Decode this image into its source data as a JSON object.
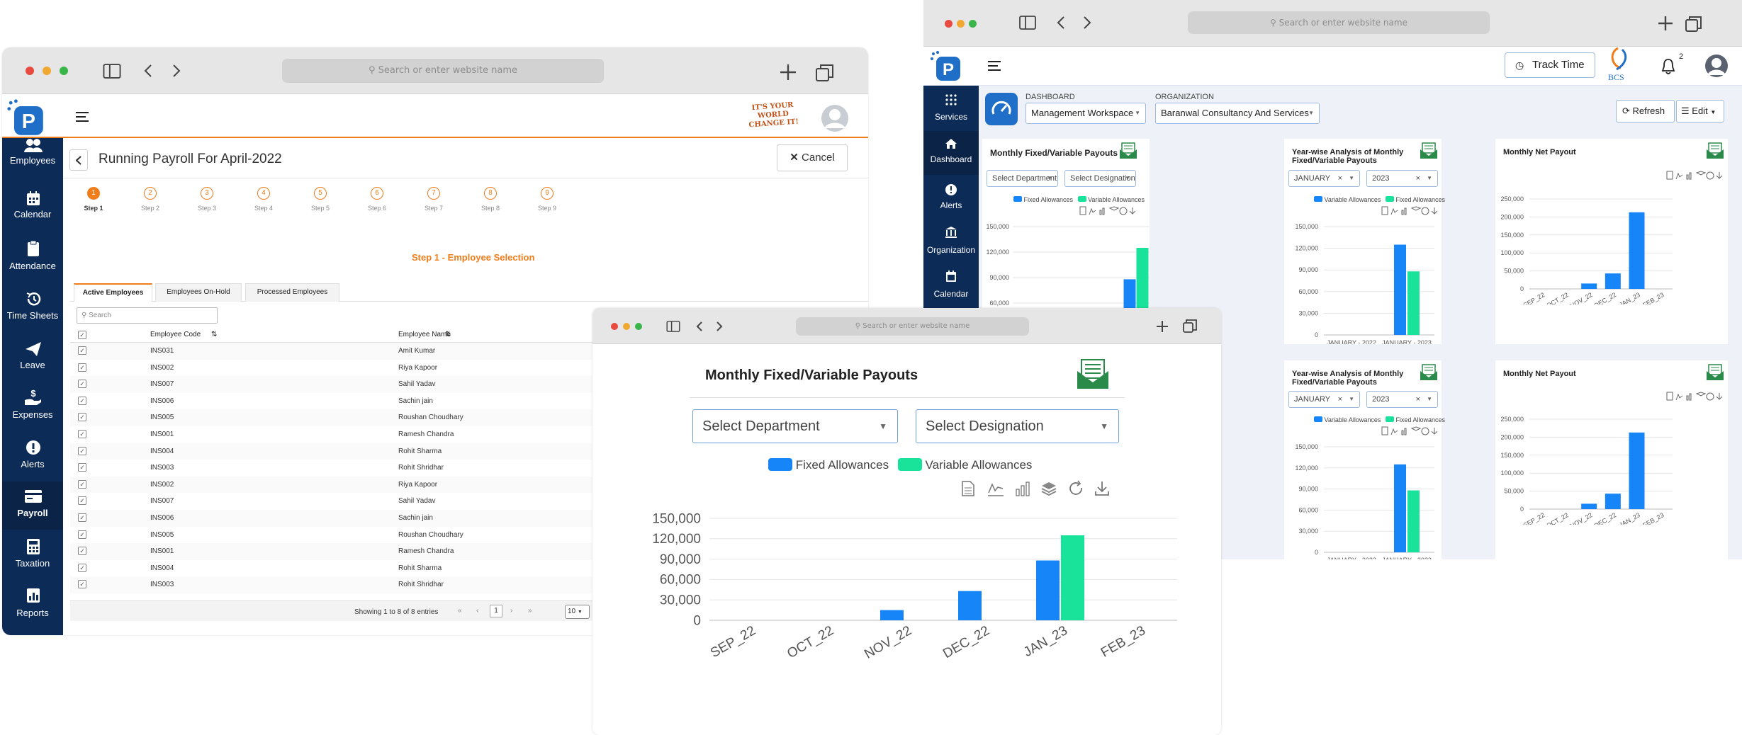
{
  "colors": {
    "sidebar": "#0d2b57",
    "accent": "#f07d1a",
    "blue": "#1685f7",
    "green": "#19e29a",
    "nav_active": "#0b2347"
  },
  "browser": {
    "url_placeholder": "Search or enter website name"
  },
  "left": {
    "logo_tagline": "IT'S YOUR WORLD CHANGE IT!",
    "sidebar": [
      {
        "label": "Employees",
        "icon": "users-icon"
      },
      {
        "label": "Calendar",
        "icon": "calendar-icon"
      },
      {
        "label": "Attendance",
        "icon": "clipboard-icon"
      },
      {
        "label": "Time Sheets",
        "icon": "history-icon"
      },
      {
        "label": "Leave",
        "icon": "paper-plane-icon"
      },
      {
        "label": "Expenses",
        "icon": "hand-dollar-icon"
      },
      {
        "label": "Alerts",
        "icon": "alert-icon"
      },
      {
        "label": "Payroll",
        "icon": "payroll-icon"
      },
      {
        "label": "Taxation",
        "icon": "calculator-icon"
      },
      {
        "label": "Reports",
        "icon": "reports-icon"
      }
    ],
    "page_title": "Running Payroll For April-2022",
    "cancel_label": "Cancel",
    "steps": [
      {
        "num": "1",
        "label": "Step 1"
      },
      {
        "num": "2",
        "label": "Step 2"
      },
      {
        "num": "3",
        "label": "Step 3"
      },
      {
        "num": "4",
        "label": "Step 4"
      },
      {
        "num": "5",
        "label": "Step 5"
      },
      {
        "num": "6",
        "label": "Step 6"
      },
      {
        "num": "7",
        "label": "Step 7"
      },
      {
        "num": "8",
        "label": "Step 8"
      },
      {
        "num": "9",
        "label": "Step 9"
      }
    ],
    "step_heading": "Step 1 - Employee Selection",
    "tabs": [
      "Active Employees",
      "Employees On-Hold",
      "Processed Employees"
    ],
    "search_placeholder": "Search",
    "columns": [
      "Employee Code",
      "Employee Name"
    ],
    "rows": [
      [
        "INS031",
        "Amit Kumar"
      ],
      [
        "INS002",
        "Riya Kapoor"
      ],
      [
        "INS007",
        "Sahil Yadav"
      ],
      [
        "INS006",
        "Sachin jain"
      ],
      [
        "INS005",
        "Roushan Choudhary"
      ],
      [
        "INS001",
        "Ramesh Chandra"
      ],
      [
        "INS004",
        "Rohit Sharma"
      ],
      [
        "INS003",
        "Rohit Shridhar"
      ],
      [
        "INS002",
        "Riya Kapoor"
      ],
      [
        "INS007",
        "Sahil Yadav"
      ],
      [
        "INS006",
        "Sachin jain"
      ],
      [
        "INS005",
        "Roushan Choudhary"
      ],
      [
        "INS001",
        "Ramesh Chandra"
      ],
      [
        "INS004",
        "Rohit Sharma"
      ],
      [
        "INS003",
        "Rohit Shridhar"
      ]
    ],
    "pagination": {
      "summary": "Showing 1 to 8 of 8 entries",
      "page": "1",
      "page_size": "10"
    }
  },
  "right": {
    "track_time": "Track Time",
    "company_logo": "BCS",
    "notif_count": "2",
    "sidebar": [
      {
        "label": "Services",
        "icon": "grid-icon"
      },
      {
        "label": "Dashboard",
        "icon": "home-icon"
      },
      {
        "label": "Alerts",
        "icon": "alert-icon"
      },
      {
        "label": "Organization",
        "icon": "bank-icon"
      },
      {
        "label": "Calendar",
        "icon": "calendar-icon"
      }
    ],
    "dashboard_label": "DASHBOARD",
    "dashboard_value": "Management Workspace",
    "org_label": "ORGANIZATION",
    "org_value": "Baranwal Consultancy And Services",
    "refresh": "Refresh",
    "edit": "Edit",
    "cards": {
      "c1_title": "Monthly Fixed/Variable Payouts",
      "c2_title": "Year-wise Analysis of Monthly Fixed/Variable Payouts",
      "c3_title": "Monthly Net Payout",
      "c4_title": "Year-wise Analysis of Monthly Fixed/Variable Payouts",
      "c5_title": "Monthly Net Payout",
      "select_department": "Select Department",
      "select_designation": "Select Designation",
      "month": "JANUARY",
      "year": "2023",
      "clear": "×",
      "legend_fixed": "Fixed Allowances",
      "legend_variable": "Variable Allowances"
    }
  },
  "popup": {
    "title": "Monthly Fixed/Variable Payouts",
    "select_department": "Select Department",
    "select_designation": "Select Designation",
    "legend_fixed": "Fixed Allowances",
    "legend_variable": "Variable Allowances"
  },
  "chart_data": [
    {
      "type": "bar",
      "title": "Monthly Fixed/Variable Payouts",
      "categories": [
        "SEP_22",
        "OCT_22",
        "NOV_22",
        "DEC_22",
        "JAN_23",
        "FEB_23"
      ],
      "series": [
        {
          "name": "Fixed Allowances",
          "values": [
            0,
            0,
            15000,
            43000,
            88000,
            0
          ]
        },
        {
          "name": "Variable Allowances",
          "values": [
            0,
            0,
            0,
            0,
            125000,
            0
          ]
        }
      ],
      "ylim": [
        0,
        150000
      ],
      "yticks": [
        "0",
        "30,000",
        "60,000",
        "90,000",
        "120,000",
        "150,000"
      ]
    },
    {
      "type": "bar",
      "title": "Year-wise Analysis of Monthly Fixed/Variable Payouts",
      "categories": [
        "JANUARY - 2022",
        "JANUARY - 2023"
      ],
      "series": [
        {
          "name": "Variable Allowances",
          "values": [
            0,
            125000
          ]
        },
        {
          "name": "Fixed Allowances",
          "values": [
            0,
            88000
          ]
        }
      ],
      "ylim": [
        0,
        150000
      ],
      "yticks": [
        "0",
        "30,000",
        "60,000",
        "90,000",
        "120,000",
        "150,000"
      ]
    },
    {
      "type": "bar",
      "title": "Monthly Net Payout",
      "categories": [
        "SEP_22",
        "OCT_22",
        "NOV_22",
        "DEC_22",
        "JAN_23",
        "FEB_23"
      ],
      "series": [
        {
          "values": [
            0,
            0,
            15000,
            43000,
            213000,
            0
          ]
        }
      ],
      "ylim": [
        0,
        250000
      ],
      "yticks": [
        "0",
        "50,000",
        "100,000",
        "150,000",
        "200,000",
        "250,000"
      ]
    }
  ]
}
